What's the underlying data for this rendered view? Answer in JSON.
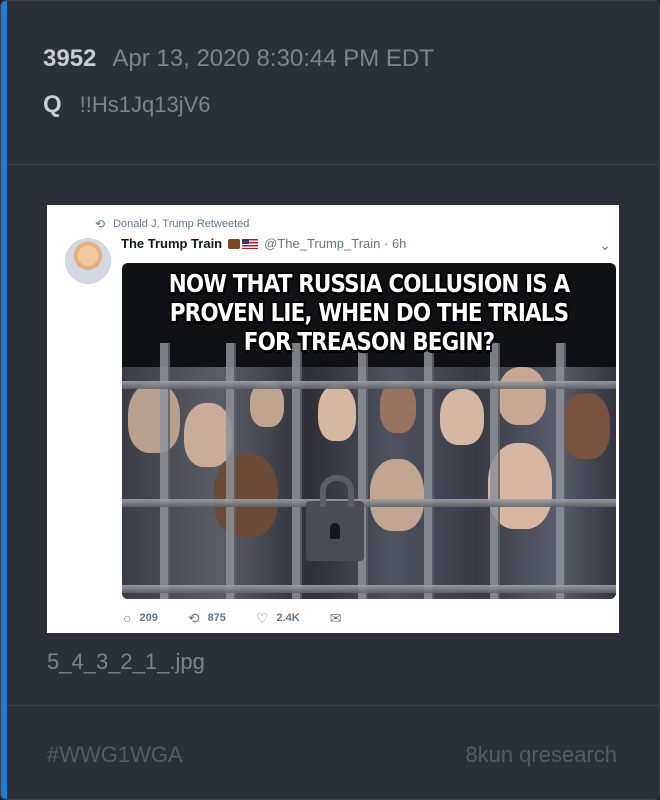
{
  "post": {
    "number": "3952",
    "date": "Apr 13, 2020 8:30:44 PM EDT",
    "author": "Q",
    "tripcode": "!!Hs1Jq13jV6"
  },
  "attachment": {
    "filename": "5_4_3_2_1_.jpg",
    "tweet": {
      "retweet_label": "Donald J. Trump Retweeted",
      "author_name": "The Trump Train",
      "author_handle": "@The_Trump_Train · 6h",
      "meme_lines": [
        "NOW THAT RUSSIA COLLUSION IS A",
        "PROVEN LIE, WHEN DO THE TRIALS",
        "FOR TREASON BEGIN?"
      ],
      "replies": "209",
      "retweets": "875",
      "likes": "2.4K"
    }
  },
  "footer": {
    "hashtag": "#WWG1WGA",
    "source": "8kun qresearch"
  },
  "colors": {
    "accent": "#1e7bd6",
    "card_bg": "#2b3038"
  }
}
